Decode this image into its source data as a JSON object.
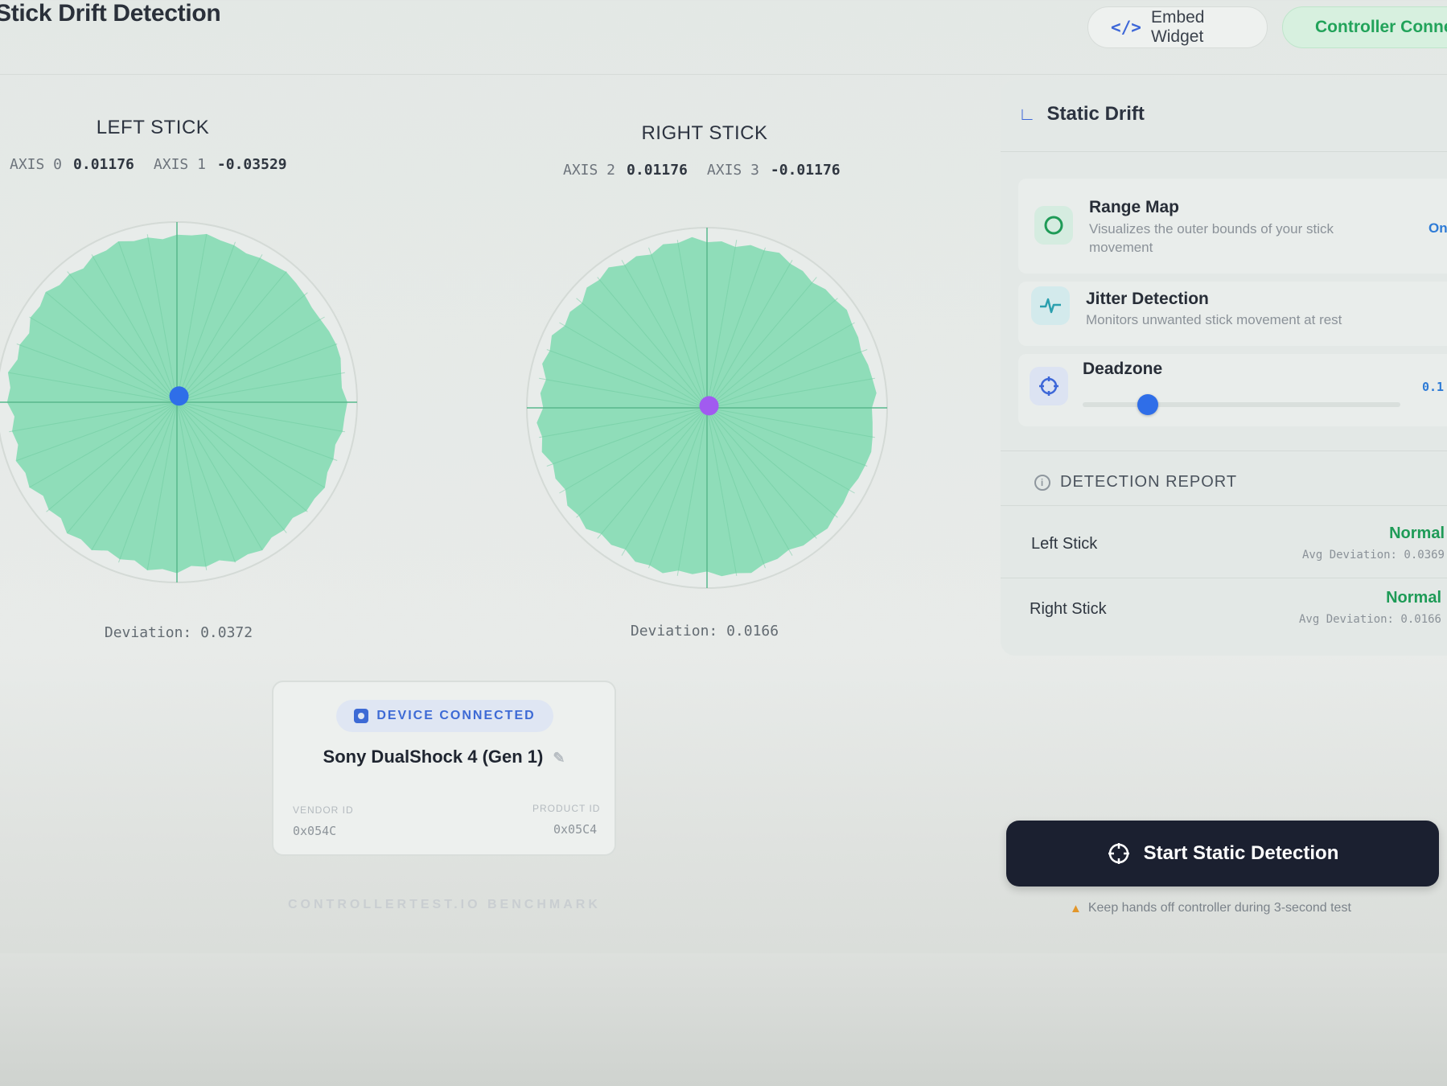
{
  "header": {
    "title": "Stick Drift Detection",
    "embed_label": "Embed Widget",
    "embed_icon": "code-icon",
    "connected_label": "Controller Connected"
  },
  "left_stick": {
    "title": "LEFT STICK",
    "axis_a_label": "AXIS 0",
    "axis_a_value": "0.01176",
    "axis_b_label": "AXIS 1",
    "axis_b_value": "-0.03529",
    "deviation": "Deviation: 0.0372",
    "dot_color": "#2f6ee8"
  },
  "right_stick": {
    "title": "RIGHT STICK",
    "axis_a_label": "AXIS 2",
    "axis_a_value": "0.01176",
    "axis_b_label": "AXIS 3",
    "axis_b_value": "-0.01176",
    "deviation": "Deviation: 0.0166",
    "dot_color": "#a15bf0"
  },
  "panel": {
    "title": "Static Drift",
    "features": [
      {
        "title": "Range Map",
        "desc": "Visualizes the outer bounds of your stick movement",
        "side": "On",
        "icon": "circle-icon"
      },
      {
        "title": "Jitter Detection",
        "desc": "Monitors unwanted stick movement at rest",
        "icon": "pulse-icon"
      },
      {
        "title": "Deadzone",
        "side": "0.1",
        "icon": "crosshair-icon"
      }
    ],
    "report": {
      "title": "DETECTION REPORT",
      "rows": [
        {
          "label": "Left Stick",
          "status": "Normal",
          "dev": "Avg Deviation: 0.0369"
        },
        {
          "label": "Right Stick",
          "status": "Normal",
          "dev": "Avg Deviation: 0.0166"
        }
      ]
    },
    "start_button": "Start Static Detection",
    "warning": "Keep hands off controller during 3-second test"
  },
  "device": {
    "badge": "DEVICE CONNECTED",
    "name": "Sony DualShock 4 (Gen 1)",
    "vendor_label": "VENDOR ID",
    "vendor_value": "0x054C",
    "product_label": "PRODUCT ID",
    "product_value": "0x05C4"
  },
  "footer": {
    "bench": "CONTROLLERTEST.IO BENCHMARK"
  },
  "colors": {
    "range_fill": "#7fdbb0",
    "accent": "#3d67d8",
    "status_ok": "#1e9b57"
  }
}
